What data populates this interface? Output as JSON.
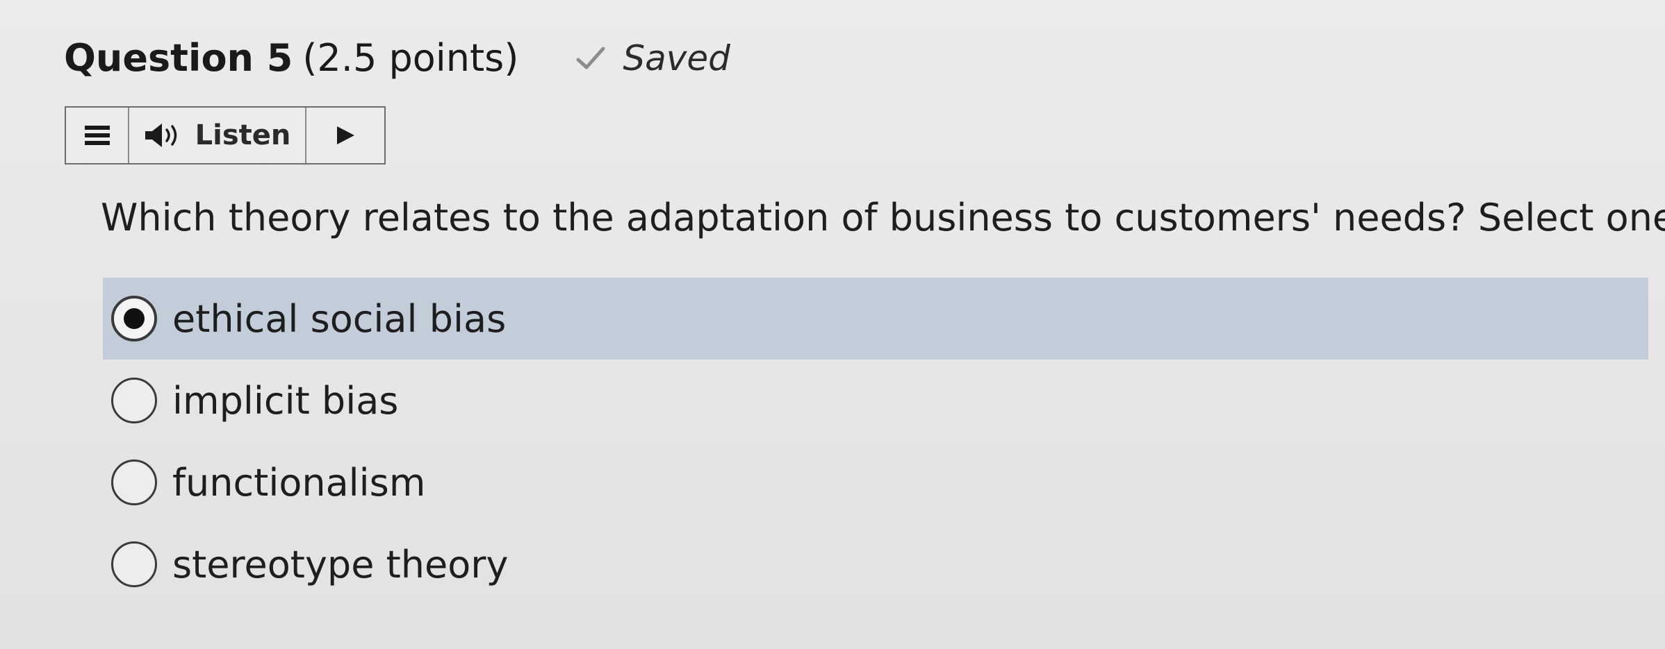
{
  "question": {
    "title": "Question 5",
    "points": "(2.5 points)",
    "status": "Saved",
    "text": "Which theory relates to the adaptation of business to customers' needs? Select one."
  },
  "toolbar": {
    "menu_icon": "hamburger-menu-icon",
    "speaker_icon": "speaker-icon",
    "listen_label": "Listen",
    "play_icon": "play-icon"
  },
  "options": [
    {
      "label": "ethical social bias",
      "selected": true
    },
    {
      "label": "implicit bias",
      "selected": false
    },
    {
      "label": "functionalism",
      "selected": false
    },
    {
      "label": "stereotype theory",
      "selected": false
    }
  ],
  "colors": {
    "selected_row": "#c3cdd9",
    "background": "#e7e6e4",
    "text": "#1e1e1e"
  }
}
